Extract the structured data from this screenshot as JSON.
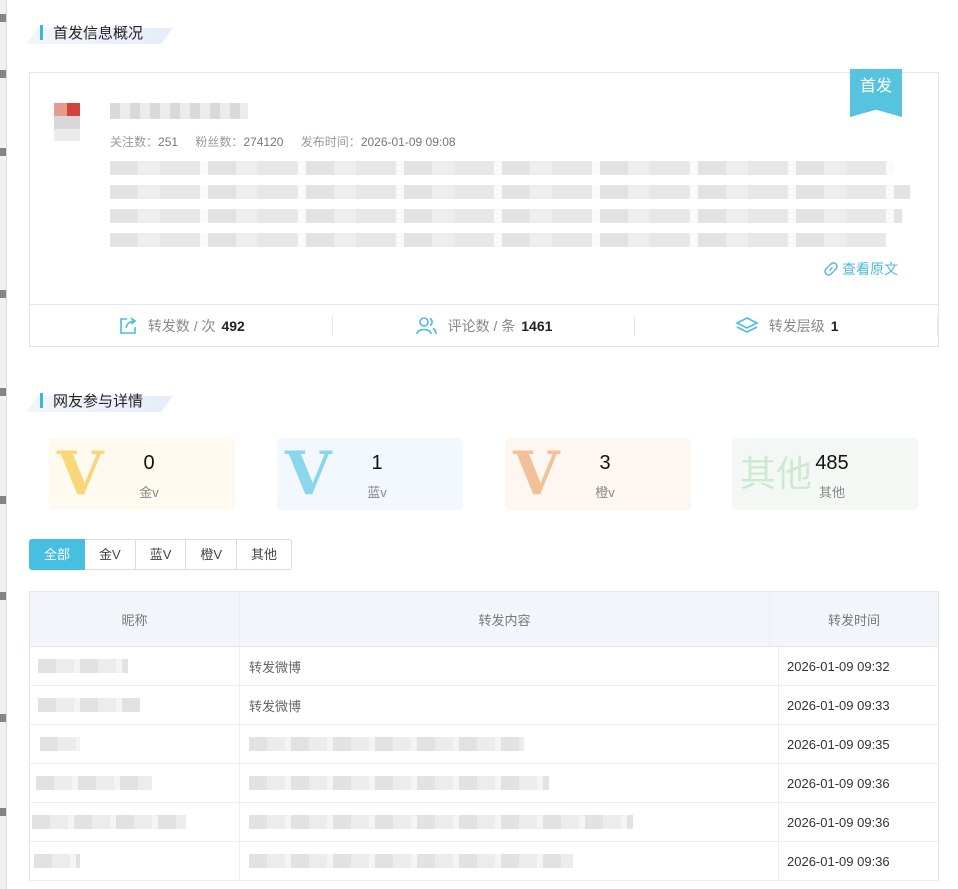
{
  "section1": {
    "title": "首发信息概况"
  },
  "post": {
    "badge": "首发",
    "meta": {
      "follow_label": "关注数：",
      "follow_value": "251",
      "fans_label": "粉丝数：",
      "fans_value": "274120",
      "time_label": "发布时间：",
      "time_value": "2026-01-09 09:08"
    },
    "view_original": "查看原文",
    "stats": [
      {
        "icon": "share-icon",
        "label": "转发数 / 次",
        "value": "492"
      },
      {
        "icon": "users-icon",
        "label": "评论数 / 条",
        "value": "1461"
      },
      {
        "icon": "layers-icon",
        "label": "转发层级",
        "value": "1"
      }
    ]
  },
  "section2": {
    "title": "网友参与详情"
  },
  "vcards": [
    {
      "mark": "V",
      "count": "0",
      "label": "金v",
      "color": "#f7d77a",
      "bg": "#fffaf0"
    },
    {
      "mark": "V",
      "count": "1",
      "label": "蓝v",
      "color": "#8bd6ec",
      "bg": "#f2f8fd"
    },
    {
      "mark": "V",
      "count": "3",
      "label": "橙v",
      "color": "#f2c19a",
      "bg": "#fdf6f1"
    },
    {
      "mark": "其他",
      "count": "485",
      "label": "其他",
      "color": "#cfe8d2",
      "bg": "#f3f8f5"
    }
  ],
  "filters": [
    "全部",
    "金V",
    "蓝V",
    "橙V",
    "其他"
  ],
  "filters_active": "全部",
  "table": {
    "headers": [
      "昵称",
      "转发内容",
      "转发时间"
    ],
    "rows": [
      {
        "content": "转发微博",
        "time": "2026-01-09 09:32"
      },
      {
        "content": "转发微博",
        "time": "2026-01-09 09:33"
      },
      {
        "content": "",
        "time": "2026-01-09 09:35"
      },
      {
        "content": "",
        "time": "2026-01-09 09:36"
      },
      {
        "content": "",
        "time": "2026-01-09 09:36"
      },
      {
        "content": "",
        "time": "2026-01-09 09:36"
      }
    ]
  },
  "colors": {
    "accent": "#47bfe0",
    "ribbon": "#56c3df"
  }
}
